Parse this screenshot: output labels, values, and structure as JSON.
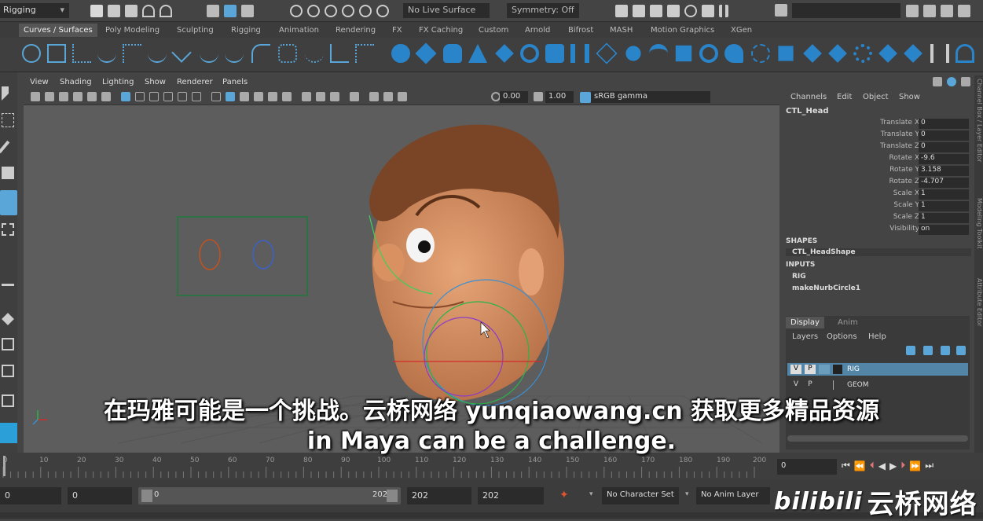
{
  "statusline": {
    "mode": "Rigging",
    "live_surface": "No Live Surface",
    "symmetry": "Symmetry: Off"
  },
  "shelf_tabs": [
    "Curves / Surfaces",
    "Poly Modeling",
    "Sculpting",
    "Rigging",
    "Animation",
    "Rendering",
    "FX",
    "FX Caching",
    "Custom",
    "Arnold",
    "Bifrost",
    "MASH",
    "Motion Graphics",
    "XGen"
  ],
  "viewport": {
    "menu": [
      "View",
      "Shading",
      "Lighting",
      "Show",
      "Renderer",
      "Panels"
    ],
    "exposure": "0.00",
    "gamma": "1.00",
    "color_space": "sRGB gamma"
  },
  "channel_box": {
    "menu": [
      "Channels",
      "Edit",
      "Object",
      "Show"
    ],
    "object": "CTL_Head",
    "attributes": [
      {
        "label": "Translate X",
        "value": "0"
      },
      {
        "label": "Translate Y",
        "value": "0"
      },
      {
        "label": "Translate Z",
        "value": "0"
      },
      {
        "label": "Rotate X",
        "value": "-9.6"
      },
      {
        "label": "Rotate Y",
        "value": "3.158"
      },
      {
        "label": "Rotate Z",
        "value": "-4.707"
      },
      {
        "label": "Scale X",
        "value": "1"
      },
      {
        "label": "Scale Y",
        "value": "1"
      },
      {
        "label": "Scale Z",
        "value": "1"
      },
      {
        "label": "Visibility",
        "value": "on"
      }
    ],
    "shapes_label": "SHAPES",
    "shape": "CTL_HeadShape",
    "inputs_label": "INPUTS",
    "inputs": [
      "RIG",
      "makeNurbCircle1"
    ]
  },
  "layer_editor": {
    "tabs": [
      "Display",
      "Anim"
    ],
    "menu": [
      "Layers",
      "Options",
      "Help"
    ],
    "layers": [
      {
        "v": "V",
        "p": "P",
        "name": "RIG"
      },
      {
        "v": "V",
        "p": "P",
        "name": "GEOM"
      }
    ]
  },
  "side_tabs": [
    "Channel Box / Layer Editor",
    "Modeling Toolkit",
    "Attribute Editor"
  ],
  "timeline": {
    "ticks": [
      "0",
      "10",
      "20",
      "30",
      "40",
      "50",
      "60",
      "70",
      "80",
      "90",
      "100",
      "110",
      "120",
      "130",
      "140",
      "150",
      "160",
      "170",
      "180",
      "190",
      "200"
    ],
    "current_frame": "0"
  },
  "range": {
    "start": "0",
    "anim_start": "0",
    "slider_start": "0",
    "slider_end": "202",
    "anim_end": "202",
    "end": "202",
    "character_set": "No Character Set",
    "anim_layer": "No Anim Layer"
  },
  "subtitles": {
    "zh": "在玛雅可能是一个挑战。云桥网络 yunqiaowang.cn  获取更多精品资源",
    "en": "in Maya can be a challenge."
  },
  "watermark": "云桥网络",
  "watermark_logo": "bilibili"
}
